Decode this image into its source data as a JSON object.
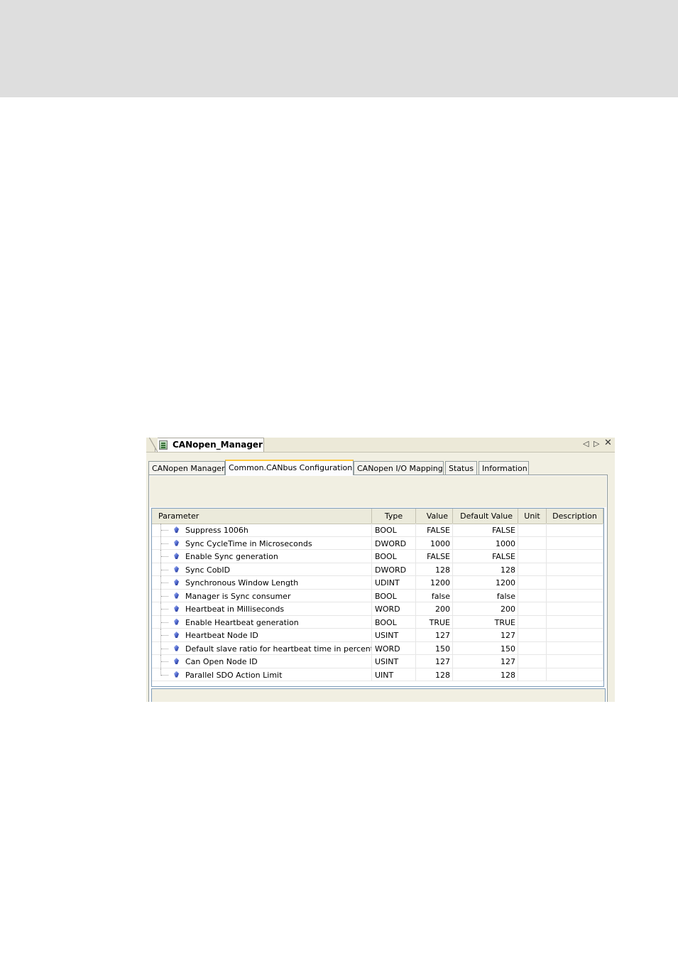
{
  "window": {
    "title": "CANopen_Manager",
    "nav_left": "◁",
    "nav_right": "▷",
    "close": "✕"
  },
  "tabs": [
    {
      "label": "CANopen Manager",
      "active": false
    },
    {
      "label": "Common.CANbus Configuration",
      "active": true
    },
    {
      "label": "CANopen I/O Mapping",
      "active": false
    },
    {
      "label": "Status",
      "active": false
    },
    {
      "label": "Information",
      "active": false
    }
  ],
  "table": {
    "headers": {
      "parameter": "Parameter",
      "type": "Type",
      "value": "Value",
      "default": "Default Value",
      "unit": "Unit",
      "description": "Description"
    },
    "rows": [
      {
        "parameter": "Suppress 1006h",
        "type": "BOOL",
        "value": "FALSE",
        "default": "FALSE",
        "unit": "",
        "description": ""
      },
      {
        "parameter": "Sync CycleTime in Microseconds",
        "type": "DWORD",
        "value": "1000",
        "default": "1000",
        "unit": "",
        "description": ""
      },
      {
        "parameter": "Enable Sync generation",
        "type": "BOOL",
        "value": "FALSE",
        "default": "FALSE",
        "unit": "",
        "description": ""
      },
      {
        "parameter": "Sync CobID",
        "type": "DWORD",
        "value": "128",
        "default": "128",
        "unit": "",
        "description": ""
      },
      {
        "parameter": "Synchronous Window Length",
        "type": "UDINT",
        "value": "1200",
        "default": "1200",
        "unit": "",
        "description": ""
      },
      {
        "parameter": "Manager is Sync consumer",
        "type": "BOOL",
        "value": "false",
        "default": "false",
        "unit": "",
        "description": ""
      },
      {
        "parameter": "Heartbeat in Milliseconds",
        "type": "WORD",
        "value": "200",
        "default": "200",
        "unit": "",
        "description": ""
      },
      {
        "parameter": "Enable Heartbeat generation",
        "type": "BOOL",
        "value": "TRUE",
        "default": "TRUE",
        "unit": "",
        "description": ""
      },
      {
        "parameter": "Heartbeat Node ID",
        "type": "USINT",
        "value": "127",
        "default": "127",
        "unit": "",
        "description": ""
      },
      {
        "parameter": "Default slave ratio for heartbeat time in percent",
        "type": "WORD",
        "value": "150",
        "default": "150",
        "unit": "",
        "description": ""
      },
      {
        "parameter": "Can Open Node ID",
        "type": "USINT",
        "value": "127",
        "default": "127",
        "unit": "",
        "description": ""
      },
      {
        "parameter": "Parallel SDO Action Limit",
        "type": "UINT",
        "value": "128",
        "default": "128",
        "unit": "",
        "description": ""
      }
    ]
  },
  "colors": {
    "active_tab_accent": "#ffc83c",
    "window_bg": "#f1efe2",
    "top_band": "#dedede"
  },
  "icons": {
    "document": "device-icon",
    "parameter": "parameter-diamond-icon"
  }
}
